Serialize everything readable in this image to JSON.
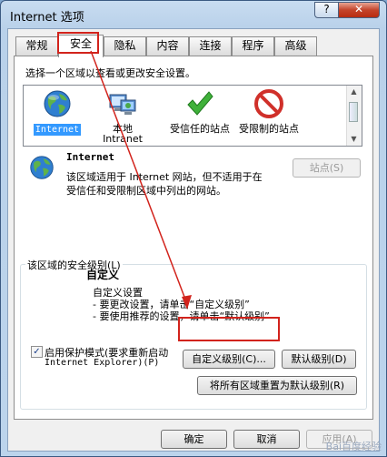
{
  "window": {
    "title": "Internet 选项",
    "help": "?",
    "close": "✕"
  },
  "tabs": [
    {
      "label": "常规",
      "active": false
    },
    {
      "label": "安全",
      "active": true
    },
    {
      "label": "隐私",
      "active": false
    },
    {
      "label": "内容",
      "active": false
    },
    {
      "label": "连接",
      "active": false
    },
    {
      "label": "程序",
      "active": false
    },
    {
      "label": "高级",
      "active": false
    }
  ],
  "security": {
    "zones_prompt": "选择一个区域以查看或更改安全设置。",
    "zones": [
      {
        "label": "Internet",
        "icon": "globe-icon",
        "selected": true
      },
      {
        "label": "本地 Intranet",
        "icon": "intranet-icon",
        "selected": false
      },
      {
        "label": "受信任的站点",
        "icon": "checkmark-icon",
        "selected": false
      },
      {
        "label": "受限制的站点",
        "icon": "no-entry-icon",
        "selected": false
      }
    ],
    "zone_title": "Internet",
    "zone_desc_line1": "该区域适用于 Internet 网站，但不适用于在",
    "zone_desc_line2": "受信任和受限制区域中列出的网站。",
    "sites_button": "站点(S)",
    "level_group_title": "该区域的安全级别(L)",
    "level_name": "自定义",
    "level_line1": "自定义设置",
    "level_line2": "- 要更改设置，请单击“自定义级别”",
    "level_line3": "- 要使用推荐的设置，请单击“默认级别”",
    "protected_mode_line1": "启用保护模式(要求重新启动",
    "protected_mode_line2": "Internet Explorer)(P)",
    "protected_mode_checked": true,
    "custom_level_button": "自定义级别(C)...",
    "default_level_button": "默认级别(D)",
    "reset_all_button": "将所有区域重置为默认级别(R)"
  },
  "footer": {
    "ok": "确定",
    "cancel": "取消",
    "apply": "应用(A)"
  },
  "watermark": "Bai百度经验",
  "colors": {
    "annotation_red": "#d2231c",
    "selection_blue": "#3399ff"
  }
}
